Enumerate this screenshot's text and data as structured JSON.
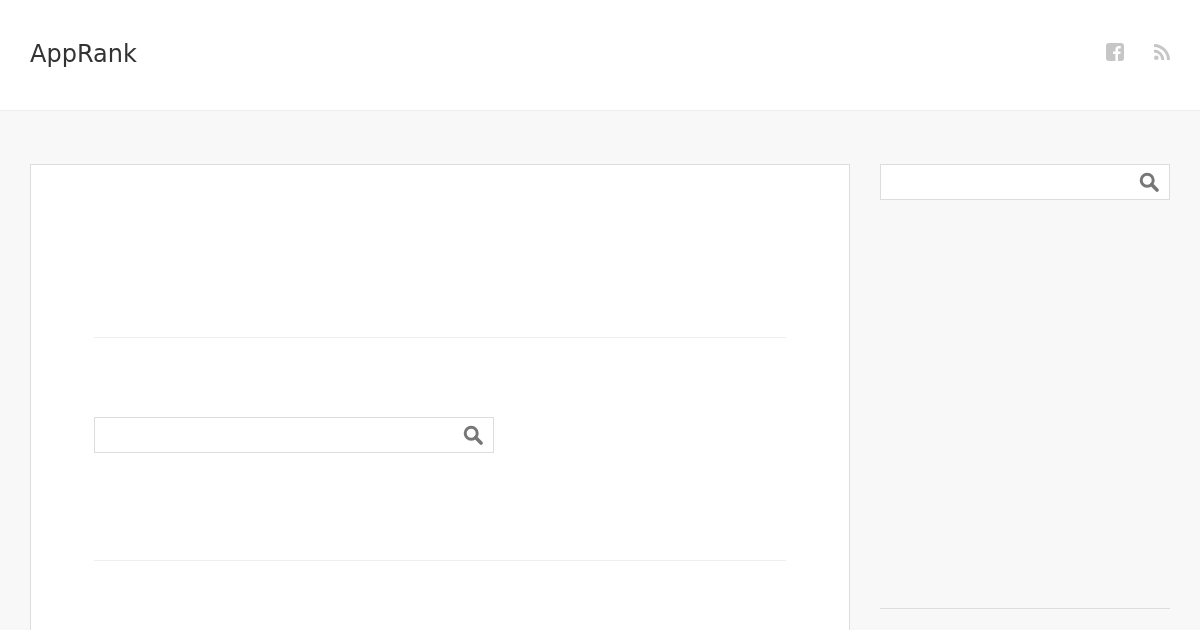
{
  "header": {
    "site_title": "AppRank"
  }
}
